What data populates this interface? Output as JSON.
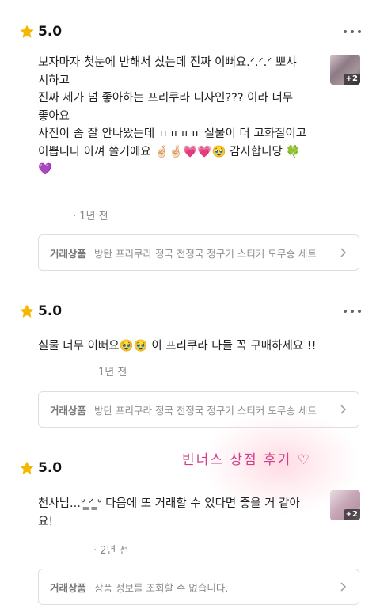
{
  "reviews": [
    {
      "rating": "5.0",
      "text": "보자마자 첫눈에 반해서 샀는데 진짜 이뻐요.ᐟ.ᐟ.ᐟ 뽀샤시하고\n진짜 제가 넘 좋아하는 프리쿠라 디자인??? 이라 너무 좋아요\n사진이 좀 잘 안나왔는데 ㅠㅠㅠㅠ 실물이 더 고화질이고 이쁩니다 아껴 쓸거에요 🤞🏻🤞🏻💗💗🥹 감사합니당 🍀💜",
      "photo_extra": "+2",
      "time": "· 1년 전",
      "product_label": "거래상품",
      "product_name": "방탄 프리쿠라 정국 전정국 정구기 스티커 도무송 세트"
    },
    {
      "rating": "5.0",
      "text": "실물 너무 이뻐요🥹🥹 이 프리쿠라 다들 꼭 구매하세요 !!",
      "time": "1년 전",
      "product_label": "거래상품",
      "product_name": "방탄 프리쿠라 정국 전정국 정구기 스티커 도무송 세트"
    },
    {
      "rating": "5.0",
      "text": "천사님...ᐡ ̳ᐟ ̳ᐡ 다음에 또 거래할 수 있다면 좋을 거 같아요!",
      "photo_extra": "+2",
      "time": "· 2년 전",
      "product_label": "거래상품",
      "product_name": "상품 정보를 조회할 수 없습니다."
    }
  ],
  "decoration_text": "빈너스 상점 후기 ♡",
  "colors": {
    "star": "#f5b800",
    "accent_pink": "#d23d8a",
    "border": "#dedede"
  },
  "icons": {
    "rating": "star-icon",
    "menu": "more-dots-icon",
    "arrow": "chevron-right-icon"
  }
}
